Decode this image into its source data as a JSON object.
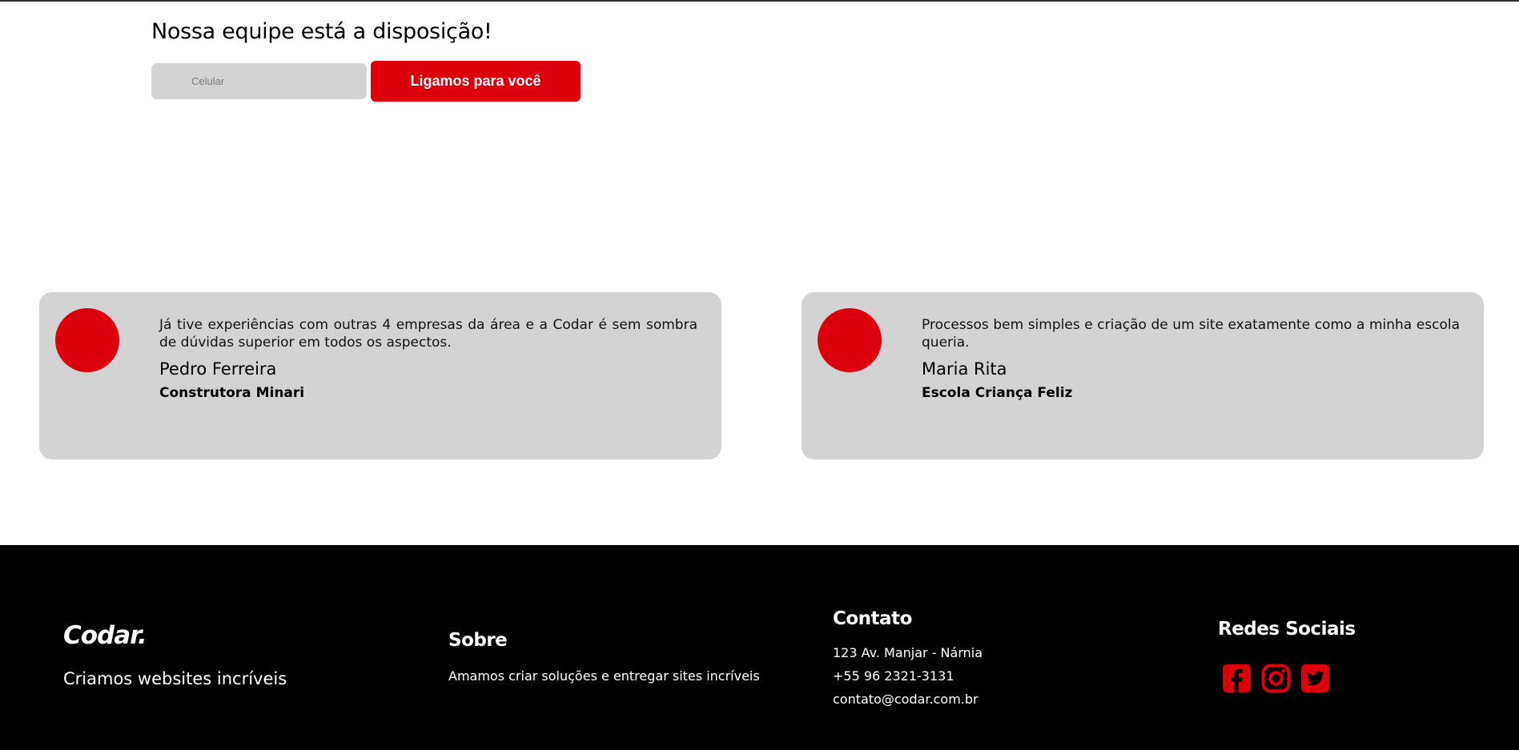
{
  "cta": {
    "title": "Nossa equipe está a disposição!",
    "input_placeholder": "Celular",
    "button_label": "Ligamos para você"
  },
  "testimonials": [
    {
      "quote": "Já tive experiências com outras 4 empresas da área e a Codar é sem sombra de dúvidas superior em todos os aspectos.",
      "author": "Pedro Ferreira",
      "company": "Construtora Minari"
    },
    {
      "quote": "Processos bem simples e criação de um site exatamente como a minha escola queria.",
      "author": "Maria Rita",
      "company": "Escola Criança Feliz"
    }
  ],
  "footer": {
    "brand": "Codar.",
    "tagline": "Criamos websites incríveis",
    "sobre": {
      "title": "Sobre",
      "text": "Amamos criar soluções e entregar sites incríveis"
    },
    "contato": {
      "title": "Contato",
      "address": "123 Av. Manjar - Nárnia",
      "phone": "+55 96 2321-3131",
      "email": "contato@codar.com.br"
    },
    "redes": {
      "title": "Redes Sociais",
      "icons": [
        "facebook-icon",
        "instagram-icon",
        "twitter-icon"
      ]
    }
  },
  "colors": {
    "accent": "#db000c",
    "card_bg": "#d3d3d3",
    "footer_bg": "#000000"
  }
}
